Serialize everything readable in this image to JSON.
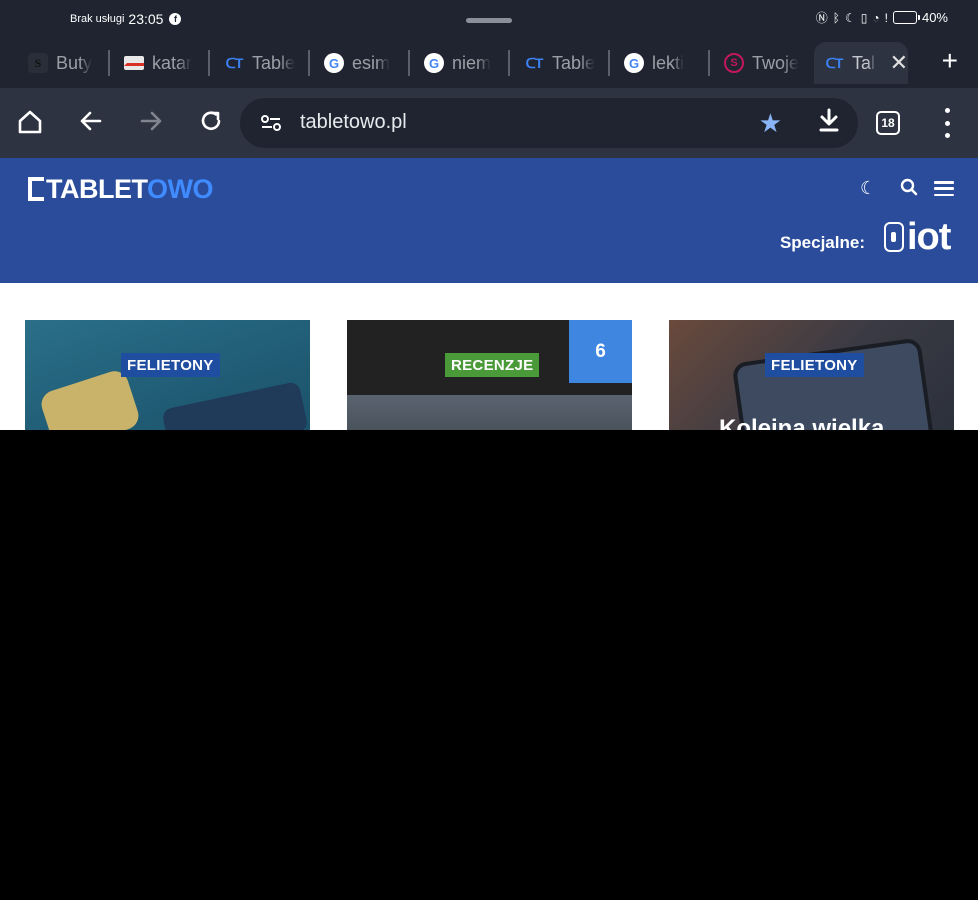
{
  "status_bar": {
    "carrier": "Brak usługi",
    "time": "23:05",
    "battery_level": 0.4,
    "battery_text": "40%"
  },
  "tabs": [
    {
      "label": "Buty",
      "favicon": "s-icon"
    },
    {
      "label": "katar",
      "favicon": "mail-icon"
    },
    {
      "label": "Table",
      "favicon": "tabletowo-icon"
    },
    {
      "label": "esim",
      "favicon": "google-icon"
    },
    {
      "label": "niem",
      "favicon": "google-icon"
    },
    {
      "label": "Table",
      "favicon": "tabletowo-icon"
    },
    {
      "label": "lekti",
      "favicon": "google-icon"
    },
    {
      "label": "Twoje",
      "favicon": "s-circle-icon"
    },
    {
      "label": "Tal",
      "favicon": "tabletowo-icon",
      "active": true
    }
  ],
  "toolbar": {
    "url": "tabletowo.pl",
    "tab_count": "18"
  },
  "site": {
    "logo_part1": "TABLET",
    "logo_part2": "OWO",
    "special_label": "Specjalne:",
    "special_brand": "iot"
  },
  "cards": [
    {
      "category": "FELIETONY",
      "category_color": "#1f4da0"
    },
    {
      "category": "RECENZJE",
      "category_color": "#4a9a3a",
      "comment_count": "6"
    },
    {
      "category": "FELIETONY",
      "category_color": "#1f4da0",
      "title": "Kolejna wielka"
    }
  ],
  "colors": {
    "header_bg": "#2a4c9b",
    "browser_bg": "#1f2430",
    "toolbar_bg": "#2d3340",
    "accent": "#3f86e0"
  }
}
